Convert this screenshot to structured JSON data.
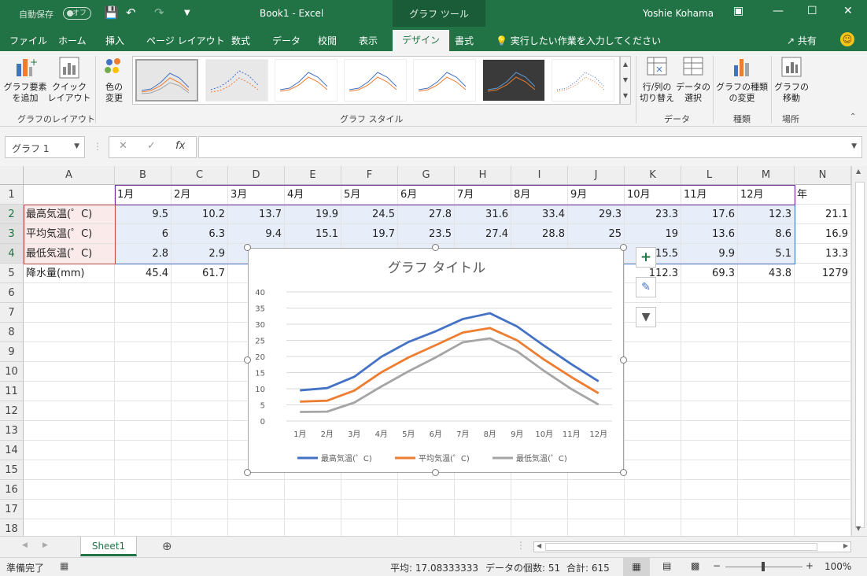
{
  "titlebar": {
    "autosave_label": "自動保存",
    "autosave_state": "オフ",
    "document_title": "Book1  -  Excel",
    "context_tab": "グラフ ツール",
    "user_name": "Yoshie Kohama"
  },
  "tabs": [
    "ファイル",
    "ホーム",
    "挿入",
    "ページ レイアウト",
    "数式",
    "データ",
    "校閲",
    "表示",
    "デザイン",
    "書式"
  ],
  "active_tab": "デザイン",
  "tell_me": "実行したい作業を入力してください",
  "share_label": "共有",
  "ribbon": {
    "add_element": "グラフ要素\nを追加",
    "quick_layout": "クイック\nレイアウト",
    "layout_group": "グラフのレイアウト",
    "change_colors": "色の\n変更",
    "styles_group": "グラフ スタイル",
    "switch_rowcol": "行/列の\n切り替え",
    "select_data": "データの\n選択",
    "data_group": "データ",
    "change_type": "グラフの種類\nの変更",
    "type_group": "種類",
    "move_chart": "グラフの\n移動",
    "location_group": "場所"
  },
  "namebox": "グラフ 1",
  "columns": [
    "A",
    "B",
    "C",
    "D",
    "E",
    "F",
    "G",
    "H",
    "I",
    "J",
    "K",
    "L",
    "M",
    "N"
  ],
  "rows": [
    "1",
    "2",
    "3",
    "4",
    "5",
    "6",
    "7",
    "8",
    "9",
    "10",
    "11",
    "12",
    "13",
    "14",
    "15",
    "16",
    "17",
    "18"
  ],
  "sheet": {
    "header_row": [
      "",
      "1月",
      "2月",
      "3月",
      "4月",
      "5月",
      "6月",
      "7月",
      "8月",
      "9月",
      "10月",
      "11月",
      "12月",
      "年"
    ],
    "data_rows": [
      {
        "label": "最高気温(゜C)",
        "values": [
          "9.5",
          "10.2",
          "13.7",
          "19.9",
          "24.5",
          "27.8",
          "31.6",
          "33.4",
          "29.3",
          "23.3",
          "17.6",
          "12.3",
          "21.1"
        ]
      },
      {
        "label": "平均気温(゜C)",
        "values": [
          "6",
          "6.3",
          "9.4",
          "15.1",
          "19.7",
          "23.5",
          "27.4",
          "28.8",
          "25",
          "19",
          "13.6",
          "8.6",
          "16.9"
        ]
      },
      {
        "label": "最低気温(゜C)",
        "values": [
          "2.8",
          "2.9",
          "",
          "",
          "",
          "",
          "",
          "",
          "",
          "15.5",
          "9.9",
          "5.1",
          "13.3"
        ]
      },
      {
        "label": "降水量(mm)",
        "values": [
          "45.4",
          "61.7",
          "",
          "",
          "",
          "",
          "",
          "",
          "",
          "112.3",
          "69.3",
          "43.8",
          "1279"
        ]
      }
    ]
  },
  "chart_data": {
    "type": "line",
    "title": "グラフ タイトル",
    "categories": [
      "1月",
      "2月",
      "3月",
      "4月",
      "5月",
      "6月",
      "7月",
      "8月",
      "9月",
      "10月",
      "11月",
      "12月"
    ],
    "ylim": [
      0,
      40
    ],
    "yticks": [
      "0",
      "5",
      "10",
      "15",
      "20",
      "25",
      "30",
      "35",
      "40"
    ],
    "grid": true,
    "legend_position": "bottom",
    "series": [
      {
        "name": "最高気温(゜C)",
        "color": "#4472c4",
        "values": [
          9.5,
          10.2,
          13.7,
          19.9,
          24.5,
          27.8,
          31.6,
          33.4,
          29.3,
          23.3,
          17.6,
          12.3
        ]
      },
      {
        "name": "平均気温(゜C)",
        "color": "#ed7d31",
        "values": [
          6,
          6.3,
          9.4,
          15.1,
          19.7,
          23.5,
          27.4,
          28.8,
          25,
          19,
          13.6,
          8.6
        ]
      },
      {
        "name": "最低気温(゜C)",
        "color": "#a5a5a5",
        "values": [
          2.8,
          2.9,
          5.7,
          10.7,
          15.4,
          19.7,
          24.4,
          25.6,
          21.6,
          15.5,
          9.9,
          5.1
        ]
      }
    ]
  },
  "sheet_tab": "Sheet1",
  "status": {
    "ready": "準備完了",
    "average": "平均: 17.08333333",
    "count": "データの個数: 51",
    "sum": "合計: 615",
    "zoom": "100%"
  }
}
